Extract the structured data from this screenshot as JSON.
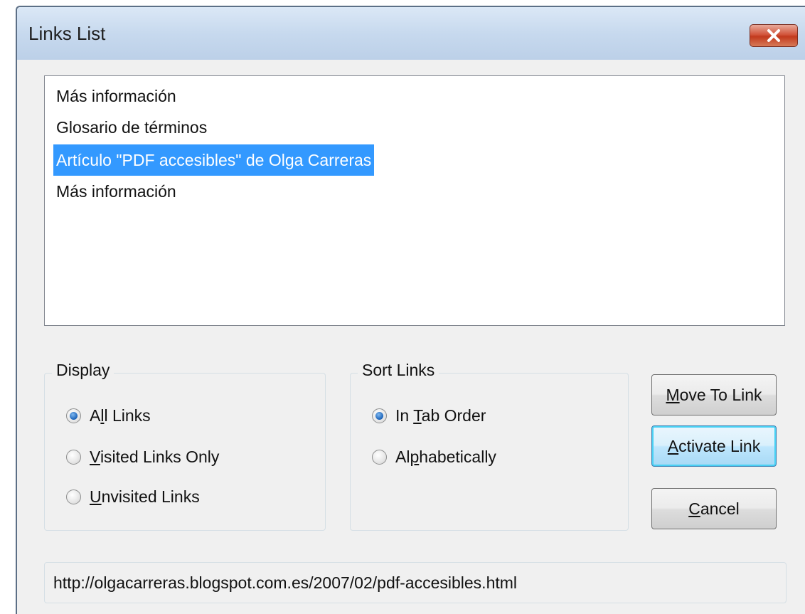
{
  "window": {
    "title": "Links List",
    "close_icon": "close-icon"
  },
  "links": [
    {
      "label": "Más información",
      "selected": false
    },
    {
      "label": "Glosario de términos",
      "selected": false
    },
    {
      "label": "Artículo \"PDF accesibles\" de Olga Carreras",
      "selected": true
    },
    {
      "label": "Más información",
      "selected": false
    }
  ],
  "display_group": {
    "label": "Display",
    "options": [
      {
        "pre": "A",
        "key": "l",
        "post": "l Links",
        "checked": true
      },
      {
        "pre": "",
        "key": "V",
        "post": "isited Links Only",
        "checked": false
      },
      {
        "pre": "",
        "key": "U",
        "post": "nvisited Links",
        "checked": false
      }
    ]
  },
  "sort_group": {
    "label": "Sort Links",
    "options": [
      {
        "pre": "In ",
        "key": "T",
        "post": "ab Order",
        "checked": true
      },
      {
        "pre": "Al",
        "key": "p",
        "post": "habetically",
        "checked": false
      }
    ]
  },
  "buttons": {
    "move": {
      "pre": "",
      "key": "M",
      "post": "ove To Link"
    },
    "activate": {
      "pre": "",
      "key": "A",
      "post": "ctivate Link"
    },
    "cancel": {
      "pre": "",
      "key": "C",
      "post": "ancel"
    }
  },
  "url": "http://olgacarreras.blogspot.com.es/2007/02/pdf-accesibles.html",
  "colors": {
    "selection": "#3399ff",
    "close_button": "#c23a1d",
    "radio_checked": "#1a62b8"
  }
}
